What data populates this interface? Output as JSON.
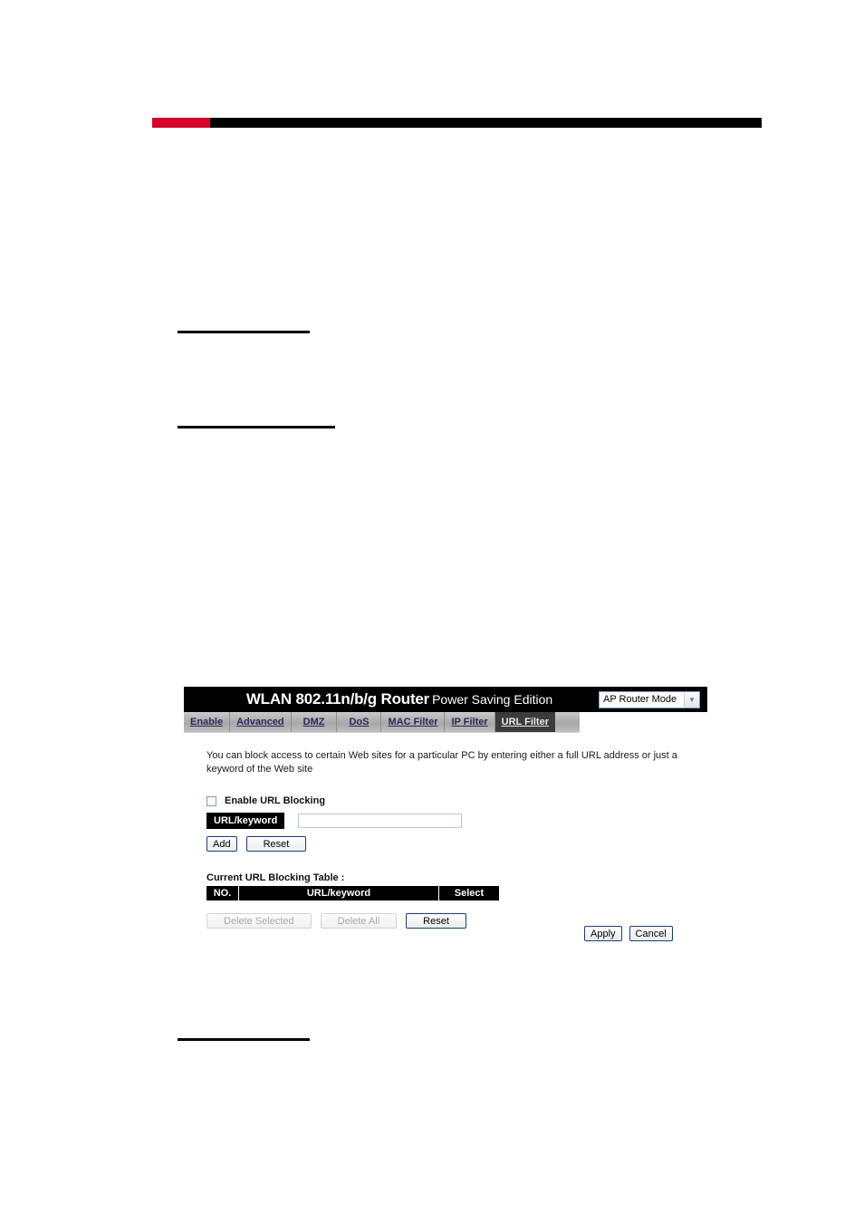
{
  "page": {
    "accent_color": "#d80027",
    "rule_color": "#000000"
  },
  "router_ui": {
    "header": {
      "title_main": "WLAN 802.11n/b/g Router",
      "title_sub": "Power Saving Edition",
      "mode_select": {
        "value": "AP Router Mode",
        "arrow_icon": "chevron-down-icon"
      }
    },
    "tabs": [
      {
        "label": "Enable",
        "active": false
      },
      {
        "label": "Advanced",
        "active": false
      },
      {
        "label": "DMZ",
        "active": false
      },
      {
        "label": "DoS",
        "active": false
      },
      {
        "label": "MAC Filter",
        "active": false
      },
      {
        "label": "IP Filter",
        "active": false
      },
      {
        "label": "URL Filter",
        "active": true
      }
    ],
    "body": {
      "description": "You can block access to certain Web sites for a particular PC by entering either a full URL address or just a keyword of the Web site",
      "enable_blocking": {
        "label": "Enable URL Blocking",
        "checked": false
      },
      "url_field": {
        "tag_label": "URL/keyword",
        "value": "",
        "placeholder": ""
      },
      "entry_buttons": {
        "add_label": "Add",
        "reset_label": "Reset"
      },
      "table": {
        "caption": "Current URL Blocking Table :",
        "columns": [
          "NO.",
          "URL/keyword",
          "Select"
        ],
        "rows": []
      },
      "table_buttons": {
        "delete_selected_label": "Delete Selected",
        "delete_selected_disabled": true,
        "delete_all_label": "Delete All",
        "delete_all_disabled": true,
        "reset_label": "Reset",
        "reset_disabled": false
      }
    },
    "footer_buttons": {
      "apply_label": "Apply",
      "cancel_label": "Cancel"
    }
  }
}
